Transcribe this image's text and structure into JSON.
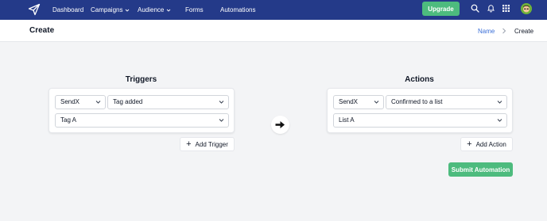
{
  "nav": {
    "items": [
      {
        "label": "Dashboard",
        "has_dropdown": false
      },
      {
        "label": "Campaigns",
        "has_dropdown": true
      },
      {
        "label": "Audience",
        "has_dropdown": true
      },
      {
        "label": "Forms",
        "has_dropdown": false
      },
      {
        "label": "Automations",
        "has_dropdown": false
      }
    ],
    "upgrade_label": "Upgrade",
    "icons": [
      "search-icon",
      "bell-icon",
      "apps-grid-icon",
      "avatar"
    ]
  },
  "header": {
    "title": "Create",
    "breadcrumb": {
      "link": "Name",
      "current": "Create"
    }
  },
  "triggers": {
    "title": "Triggers",
    "source": "SendX",
    "event": "Tag added",
    "value": "Tag A",
    "add_label": "Add Trigger"
  },
  "actions": {
    "title": "Actions",
    "source": "SendX",
    "event": "Confirmed to a list",
    "value": "List A",
    "add_label": "Add Action"
  },
  "submit_label": "Submit Automation",
  "colors": {
    "nav_bg": "#243a89",
    "accent_green": "#4dbb7e",
    "link_blue": "#3b6fd8",
    "page_bg": "#f3f4f6"
  }
}
